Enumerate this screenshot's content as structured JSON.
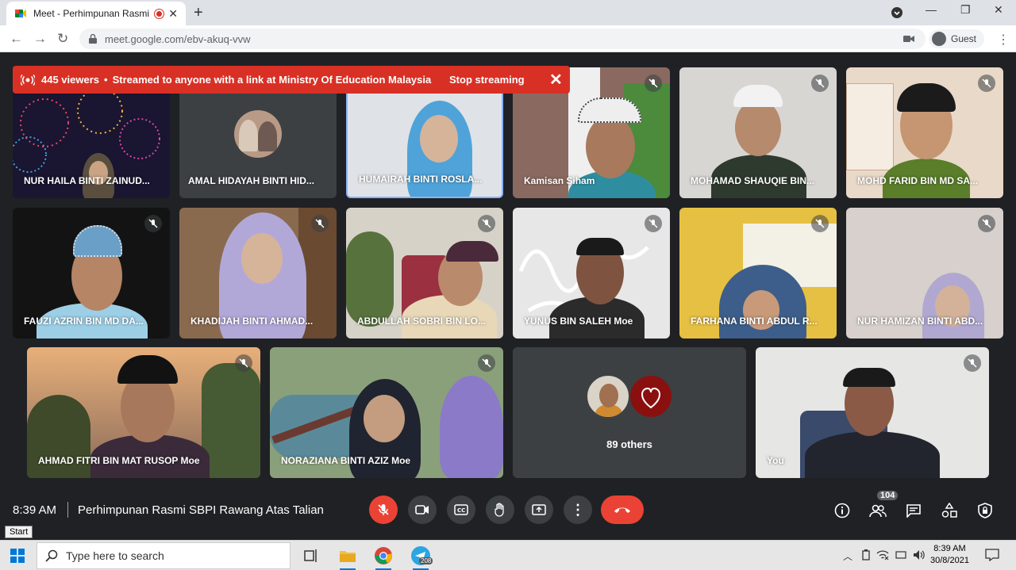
{
  "browser": {
    "tab_title": "Meet - Perhimpunan Rasmi S",
    "url": "meet.google.com/ebv-akuq-vvw",
    "profile_label": "Guest"
  },
  "streaming": {
    "viewers": "445 viewers",
    "bullet": "•",
    "message": "Streamed to anyone with a link at Ministry Of Education Malaysia",
    "stop_label": "Stop streaming"
  },
  "participants": [
    {
      "name": "NUR HAILA BINTI ZAINUD..."
    },
    {
      "name": "AMAL HIDAYAH BINTI HID..."
    },
    {
      "name": "HUMAIRAH BINTI ROSLA..."
    },
    {
      "name": "Kamisan Siham"
    },
    {
      "name": "MOHAMAD SHAUQIE BIN..."
    },
    {
      "name": "MOHD FARID BIN MD SA..."
    },
    {
      "name": "FAUZI AZRIN BIN MD DA..."
    },
    {
      "name": "KHADIJAH BINTI AHMAD..."
    },
    {
      "name": "ABDULLAH SOBRI BIN LO..."
    },
    {
      "name": "YUNUS BIN SALEH Moe"
    },
    {
      "name": "FARHANA BINTI ABDUL R..."
    },
    {
      "name": "NUR HAMIZAN BINTI ABD..."
    },
    {
      "name": "AHMAD FITRI BIN MAT RUSOP Moe"
    },
    {
      "name": "NORAZIANA BINTI AZIZ Moe"
    },
    {
      "name": "You"
    }
  ],
  "others_label": "89 others",
  "meeting": {
    "time": "8:39 AM",
    "title": "Perhimpunan Rasmi SBPI Rawang Atas Talian",
    "people_count": "104"
  },
  "start_tooltip": "Start",
  "taskbar": {
    "search_placeholder": "Type here to search",
    "telegram_badge": "208",
    "clock_time": "8:39 AM",
    "clock_date": "30/8/2021"
  },
  "colors": {
    "meet_bg": "#202124",
    "tile_bg": "#3c4043",
    "accent_red": "#ea4335",
    "banner_red": "#d93025",
    "active_speaker": "#8ab4f8"
  }
}
